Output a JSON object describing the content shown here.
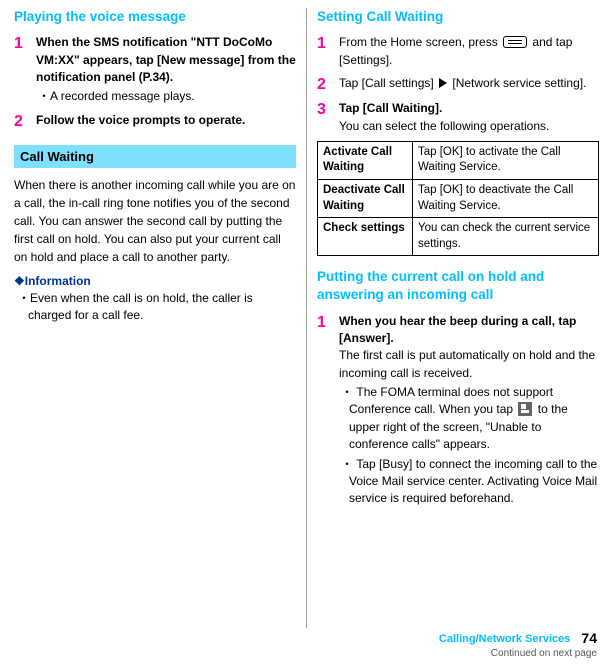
{
  "left": {
    "heading1": "Playing the voice message",
    "step1": {
      "bold": "When the SMS notification \"NTT DoCoMo VM:XX\" appears, tap [New message] from the notification panel (P.34).",
      "bullet": "A recorded message plays."
    },
    "step2": {
      "bold": "Follow the voice prompts to operate."
    },
    "bandTitle": "Call Waiting",
    "intro": "When there is another incoming call while you are on a call, the in-call ring tone notifies you of the second call. You can answer the second call by putting the first call on hold. You can also put your current call on hold and place a call to another party.",
    "infoHead": "❖Information",
    "infoBullet": "Even when the call is on hold, the caller is charged for a call fee."
  },
  "right": {
    "heading1": "Setting Call Waiting",
    "step1": {
      "boldA": "From the Home screen, press ",
      "boldB": " and tap [Settings]."
    },
    "step2": {
      "boldA": "Tap [Call settings] ",
      "boldB": " [Network service setting]."
    },
    "step3": {
      "bold": "Tap [Call Waiting].",
      "plain": "You can select the following operations."
    },
    "table": [
      {
        "k": "Activate Call Waiting",
        "v": "Tap [OK] to activate the Call Waiting Service."
      },
      {
        "k": "Deactivate Call Waiting",
        "v": "Tap [OK] to deactivate the Call Waiting Service."
      },
      {
        "k": "Check settings",
        "v": "You can check the current service settings."
      }
    ],
    "heading2": "Putting the current call on hold and answering an incoming call",
    "step4": {
      "bold": "When you hear the beep during a call, tap [Answer].",
      "plain": "The first call is put automatically on hold and the incoming call is received.",
      "bullet1a": "The FOMA terminal does not support Conference call. When you tap ",
      "bullet1b": " to the upper right of the screen, \"Unable to conference calls\" appears.",
      "bullet2": "Tap [Busy] to connect the incoming call to the Voice Mail service center. Activating Voice Mail service is required beforehand."
    }
  },
  "footer": {
    "svc": "Calling/Network Services",
    "page": "74",
    "cont": "Continued on next page"
  }
}
